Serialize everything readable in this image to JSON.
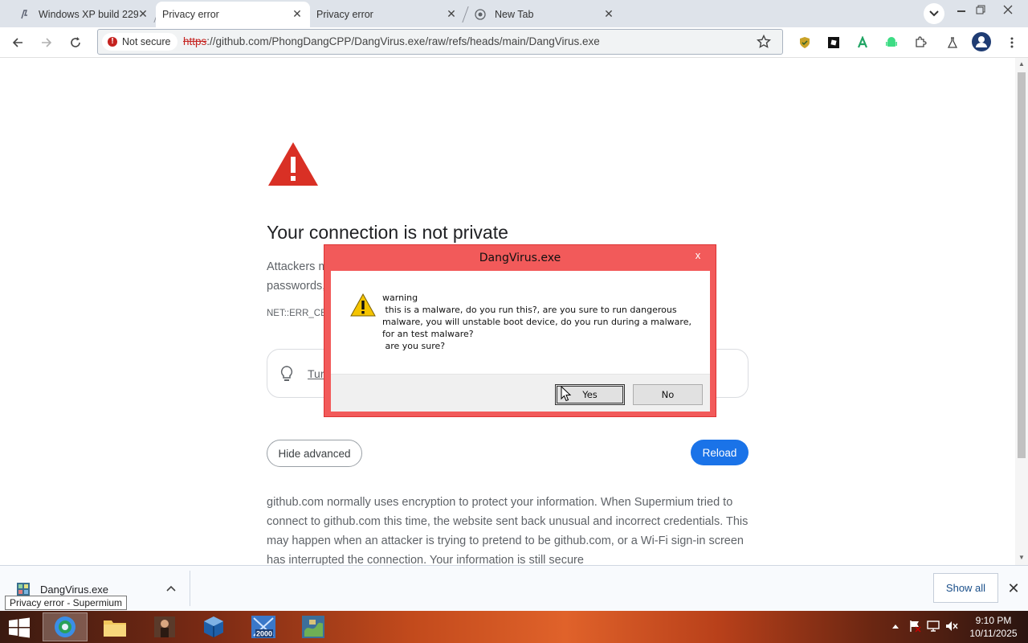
{
  "tabs": [
    {
      "title": "Windows XP build 229(",
      "active": false
    },
    {
      "title": "Privacy error",
      "active": true
    },
    {
      "title": "Privacy error",
      "active": false
    },
    {
      "title": "New Tab",
      "active": false
    }
  ],
  "omnibox": {
    "security_chip": "Not secure",
    "url_scheme": "https",
    "url_rest": "://github.com/PhongDangCPP/DangVirus.exe/raw/refs/heads/main/DangVirus.exe"
  },
  "page": {
    "title": "Your connection is not private",
    "desc_line1": "Attackers m",
    "desc_line2": "passwords,",
    "error_code": "NET::ERR_CER",
    "tip_link": "Tur",
    "hide_advanced": "Hide advanced",
    "reload": "Reload",
    "details": "github.com normally uses encryption to protect your information. When Supermium tried to connect to github.com this time, the website sent back unusual and incorrect credentials. This may happen when an attacker is trying to pretend to be github.com, or a Wi-Fi sign-in screen has interrupted the connection. Your information is still secure"
  },
  "dialog": {
    "title": "DangVirus.exe",
    "close": "x",
    "message_lines": [
      "warning",
      " this is a malware, do you run this?, are you sure to run dangerous",
      "malware, you will unstable boot device, do you run during a malware,",
      "for an test malware?",
      " are you sure?"
    ],
    "yes": "Yes",
    "no": "No"
  },
  "download_shelf": {
    "file_name": "DangVirus.exe",
    "show_all": "Show all",
    "tooltip": "Privacy error - Supermium"
  },
  "taskbar": {
    "time": "9:10 PM",
    "date": "10/11/2025",
    "app_badge": "2000"
  },
  "colors": {
    "error_red": "#d93025",
    "dialog_frame": "#f25a5a",
    "reload_blue": "#1a73e8"
  }
}
